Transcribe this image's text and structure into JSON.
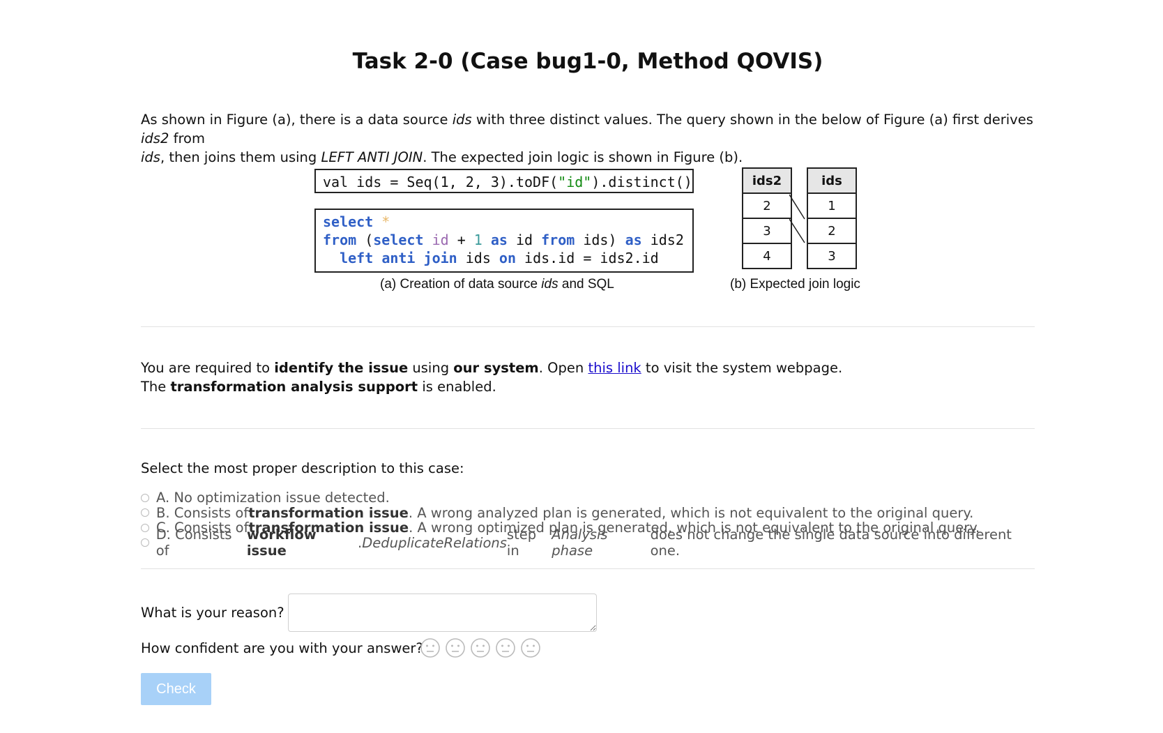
{
  "title": "Task 2-0 (Case bug1-0, Method QOVIS)",
  "intro": {
    "p1": "As shown in Figure (a), there is a data source ",
    "ids": "ids",
    "p2": " with three distinct values. The query shown in the below of Figure (a) first derives ",
    "ids2": "ids2",
    "p3": " from ",
    "ids_b": "ids",
    "p4": ", then joins them using ",
    "join": "LEFT ANTI JOIN",
    "p5": ". The expected join logic is shown in Figure (b)."
  },
  "figure_a": {
    "code1": {
      "a": "val ids = Seq(1, 2, 3).toDF(",
      "str": "\"id\"",
      "b": ").distinct()"
    },
    "code2": {
      "select": "select",
      "star": "*",
      "from": "from",
      "lparen": " (",
      "select2": "select",
      "id": "id",
      "plus": " + ",
      "one": "1",
      "as": "as",
      "id2": " id ",
      "from2": "from",
      "ids_as": " ids) ",
      "as2": "as",
      "ids2": " ids2",
      "left": "left",
      "anti": "anti",
      "join": "join",
      "ids_on": " ids ",
      "on": "on",
      "cond": " ids.id = ids2.id"
    },
    "caption_pre": "(a) Creation of data source ",
    "caption_ids": "ids",
    "caption_post": " and SQL"
  },
  "figure_b": {
    "ids2_header": "ids2",
    "ids2_values": [
      "2",
      "3",
      "4"
    ],
    "ids_header": "ids",
    "ids_values": [
      "1",
      "2",
      "3"
    ],
    "caption": "(b) Expected join logic"
  },
  "requirement": {
    "l1a": "You are required to ",
    "l1b": "identify the issue",
    "l1c": " using ",
    "l1d": "our system",
    "l1e": ". Open ",
    "link": "this link",
    "l1f": " to visit the system webpage.",
    "l2a": "The ",
    "l2b": "transformation analysis support",
    "l2c": " is enabled."
  },
  "question": {
    "title": "Select the most proper description to this case:",
    "optA": "A. No optimization issue detected.",
    "optB_pre": "B. Consists of ",
    "optB_bold": "transformation issue",
    "optB_post": ". A wrong analyzed plan is generated, which is not equivalent to the original query.",
    "optC_pre": "C. Consists of ",
    "optC_bold": "transformation issue",
    "optC_post": ". A wrong optimized plan is generated, which is not equivalent to the original query.",
    "optD_pre": "D. Consists of ",
    "optD_bold": "workflow issue",
    "optD_mid1": ". ",
    "optD_it1": "DeduplicateRelations",
    "optD_mid2": " step in ",
    "optD_it2": "Analysis phase",
    "optD_post": " does not change the single data source into different one."
  },
  "reason_label": "What is your reason?",
  "confidence_label": "How confident are you with your answer?",
  "confidence_icons": [
    "neutral-face-icon",
    "neutral-face-icon",
    "neutral-face-icon",
    "neutral-face-icon",
    "neutral-face-icon"
  ],
  "check_label": "Check",
  "colors": {
    "check_button": "#a8d1f8",
    "link": "#1a0dcc",
    "keyword": "#2f5fc6",
    "string": "#128a12"
  }
}
